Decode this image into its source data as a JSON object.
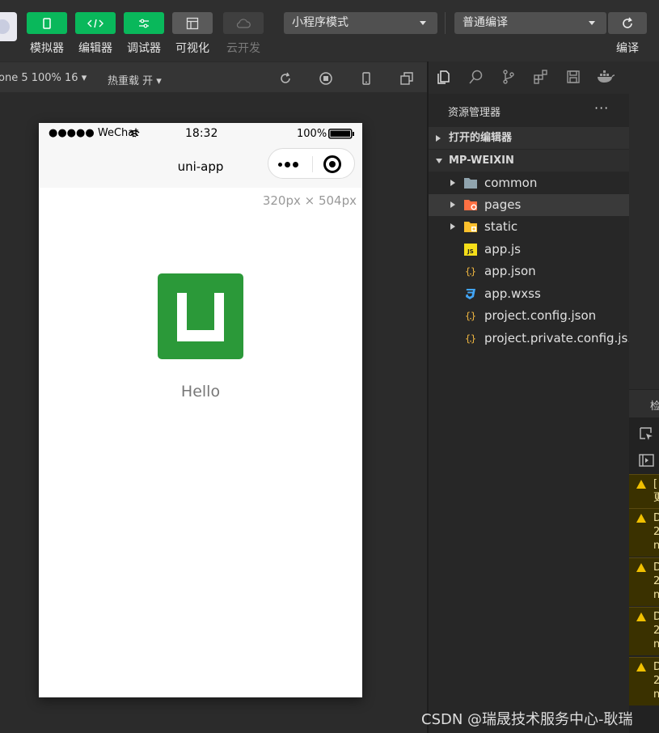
{
  "toolbar": {
    "simulator": "模拟器",
    "editor": "编辑器",
    "debugger": "调试器",
    "visualize": "可视化",
    "cloud": "云开发",
    "mode_select": "小程序模式",
    "compile_select": "普通编译",
    "compile": "编译"
  },
  "simbar": {
    "device": "one 5 100% 16 ▾",
    "hot_reload": "热重载 开 ▾"
  },
  "phone": {
    "signal": "●●●●● WeChat",
    "time": "18:32",
    "battery": "100%",
    "nav_title": "uni-app",
    "dimensions": "320px × 504px",
    "hello": "Hello"
  },
  "explorer": {
    "title": "资源管理器",
    "more": "···",
    "open_editors": "打开的编辑器",
    "project": "MP-WEIXIN",
    "items": [
      {
        "name": "common",
        "type": "folder"
      },
      {
        "name": "pages",
        "type": "folder"
      },
      {
        "name": "static",
        "type": "folder"
      },
      {
        "name": "app.js",
        "type": "js"
      },
      {
        "name": "app.json",
        "type": "json"
      },
      {
        "name": "app.wxss",
        "type": "css"
      },
      {
        "name": "project.config.json",
        "type": "json"
      },
      {
        "name": "project.private.config.js...",
        "type": "json"
      }
    ]
  },
  "console": {
    "tab": "检",
    "warnings": [
      {
        "line1": "[",
        "line2": "更"
      },
      {
        "line1": "D",
        "line2": "2",
        "line3": "n"
      },
      {
        "line1": "D",
        "line2": "2",
        "line3": "n"
      },
      {
        "line1": "D",
        "line2": "2",
        "line3": "n"
      },
      {
        "line1": "D",
        "line2": "2",
        "line3": "n"
      }
    ]
  },
  "watermark": "CSDN @瑞晟技术服务中心-耿瑞",
  "colors": {
    "accent_green": "#09b85b",
    "logo_green": "#2b9939",
    "warning_yellow": "#f0c000"
  }
}
